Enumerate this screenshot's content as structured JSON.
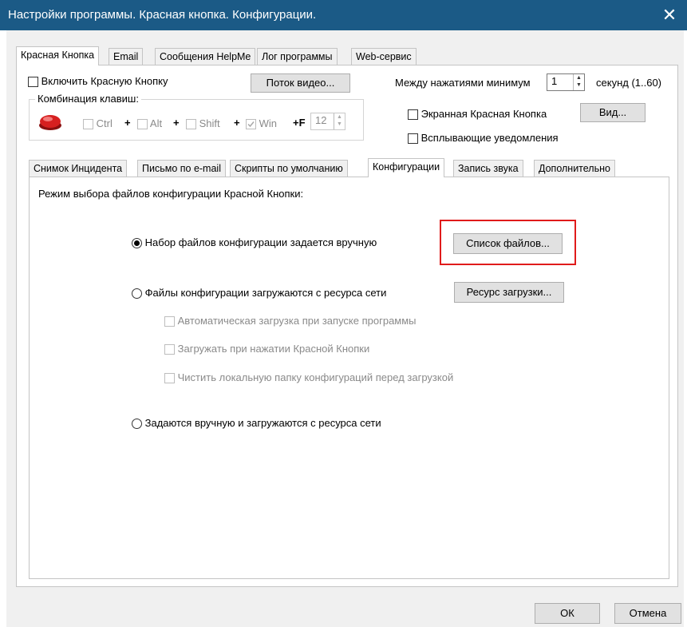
{
  "window": {
    "title": "Настройки программы. Красная кнопка. Конфигурации.",
    "close_glyph": "✕"
  },
  "top_tabs": [
    {
      "label": "Красная Кнопка",
      "active": true
    },
    {
      "label": "Email",
      "active": false
    },
    {
      "label": "Сообщения HelpMe",
      "active": false
    },
    {
      "label": "Лог программы",
      "active": false
    },
    {
      "label": "Web-сервис",
      "active": false
    }
  ],
  "general": {
    "enable_red_button_label": "Включить Красную Кнопку",
    "enable_red_button_checked": false,
    "video_stream_button": "Поток видео...",
    "min_interval_label": "Между нажатиями минимум",
    "min_interval_value": "1",
    "seconds_label": "секунд (1..60)",
    "hotkey_group_label": "Комбинация клавиш:",
    "hotkey_ctrl": "Ctrl",
    "hotkey_alt": "Alt",
    "hotkey_shift": "Shift",
    "hotkey_win": "Win",
    "plus": "+",
    "f_prefix": "+F",
    "f_value": "12",
    "screen_button_label": "Экранная Красная Кнопка",
    "view_button": "Вид...",
    "popup_notifications_label": "Всплывающие уведомления"
  },
  "inner_tabs": [
    {
      "label": "Снимок Инцидента",
      "active": false
    },
    {
      "label": "Письмо по e-mail",
      "active": false
    },
    {
      "label": "Скрипты по умолчанию",
      "active": false
    },
    {
      "label": "Конфигурации",
      "active": true
    },
    {
      "label": "Запись звука",
      "active": false
    },
    {
      "label": "Дополнительно",
      "active": false
    }
  ],
  "config": {
    "mode_label": "Режим выбора файлов конфигурации Красной Кнопки:",
    "option_manual": "Набор файлов конфигурации задается вручную",
    "file_list_button": "Список файлов...",
    "option_network": "Файлы конфигурации загружаются с ресурса сети",
    "resource_button": "Ресурс загрузки...",
    "auto_load_label": "Автоматическая загрузка при запуске программы",
    "load_on_press_label": "Загружать при нажатии Красной Кнопки",
    "clean_folder_label": "Чистить локальную папку конфигураций перед загрузкой",
    "option_both": "Задаются вручную и загружаются с ресурса сети",
    "selected_option": "manual"
  },
  "footer": {
    "ok_button": "ОК",
    "cancel_button": "Отмена"
  },
  "colors": {
    "titlebar": "#1b5a86",
    "highlight_box": "#e01b1b",
    "red_button": "#d62020"
  },
  "icons": {
    "red_button_icon": "red-panic-button",
    "spin_up": "▲",
    "spin_down": "▼"
  }
}
